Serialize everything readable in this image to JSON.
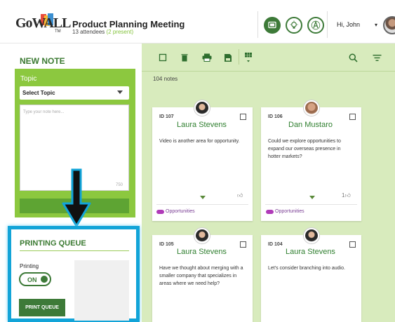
{
  "header": {
    "logo_text": "GoWALL",
    "logo_tm": "TM",
    "title": "Product Planning Meeting",
    "attendees": "13 attendees",
    "present": "(2 present)",
    "greeting": "Hi, John",
    "icons": [
      "screen-share-icon",
      "lightbulb-icon",
      "vote-icon"
    ]
  },
  "new_note": {
    "heading": "NEW NOTE",
    "topic_label": "Topic",
    "topic_select": "Select Topic",
    "note_placeholder": "Type your note here...",
    "char_count": "750"
  },
  "printing_queue": {
    "heading": "PRINTING QUEUE",
    "printing_label": "Printing",
    "toggle_label": "ON",
    "button_label": "PRINT QUEUE"
  },
  "toolbar": {
    "icons": [
      "select-all-icon",
      "trash-icon",
      "print-icon",
      "save-icon",
      "grid-view-icon",
      "search-icon",
      "filter-icon"
    ]
  },
  "notes_count": "104 notes",
  "notes": [
    {
      "id": "ID 107",
      "author": "Laura Stevens",
      "text": "Video is another area for opportunity.",
      "likes": "",
      "tag": "Opportunities"
    },
    {
      "id": "ID 106",
      "author": "Dan Mustaro",
      "text": "Could we explore opportunities to expand our overseas presence in hotter markets?",
      "likes": "1",
      "tag": "Opportunities"
    },
    {
      "id": "ID 105",
      "author": "Laura Stevens",
      "text": "Have we thought about merging with a smaller company that specializes in areas where we need help?",
      "likes": "",
      "tag": ""
    },
    {
      "id": "ID 104",
      "author": "Laura Stevens",
      "text": "Let's consider branching into audio.",
      "likes": "",
      "tag": ""
    }
  ],
  "colors": {
    "brand_green": "#3d7a38",
    "light_green": "#8cc83f",
    "board_bg": "#d8ebbd",
    "highlight_blue": "#12a4d8",
    "tag_purple": "#b03ab8"
  }
}
